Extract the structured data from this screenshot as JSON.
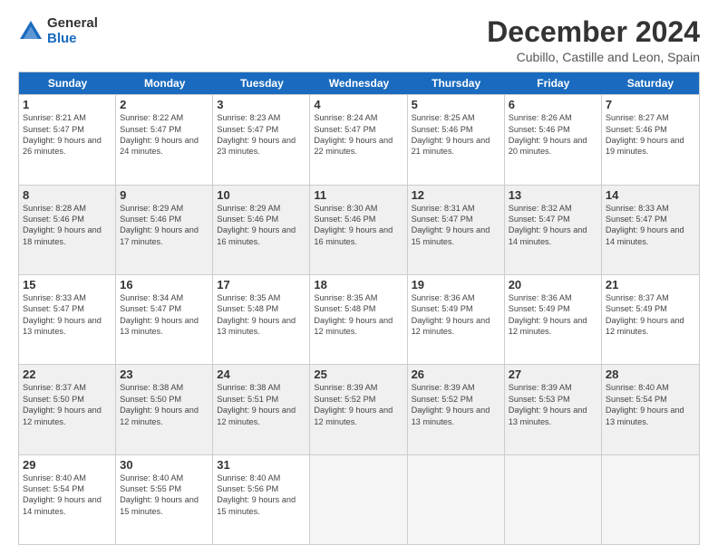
{
  "logo": {
    "general": "General",
    "blue": "Blue"
  },
  "title": "December 2024",
  "location": "Cubillo, Castille and Leon, Spain",
  "header": {
    "days": [
      "Sunday",
      "Monday",
      "Tuesday",
      "Wednesday",
      "Thursday",
      "Friday",
      "Saturday"
    ]
  },
  "weeks": [
    [
      {
        "day": "1",
        "sunrise": "Sunrise: 8:21 AM",
        "sunset": "Sunset: 5:47 PM",
        "daylight": "Daylight: 9 hours and 26 minutes.",
        "shaded": false
      },
      {
        "day": "2",
        "sunrise": "Sunrise: 8:22 AM",
        "sunset": "Sunset: 5:47 PM",
        "daylight": "Daylight: 9 hours and 24 minutes.",
        "shaded": false
      },
      {
        "day": "3",
        "sunrise": "Sunrise: 8:23 AM",
        "sunset": "Sunset: 5:47 PM",
        "daylight": "Daylight: 9 hours and 23 minutes.",
        "shaded": false
      },
      {
        "day": "4",
        "sunrise": "Sunrise: 8:24 AM",
        "sunset": "Sunset: 5:47 PM",
        "daylight": "Daylight: 9 hours and 22 minutes.",
        "shaded": false
      },
      {
        "day": "5",
        "sunrise": "Sunrise: 8:25 AM",
        "sunset": "Sunset: 5:46 PM",
        "daylight": "Daylight: 9 hours and 21 minutes.",
        "shaded": false
      },
      {
        "day": "6",
        "sunrise": "Sunrise: 8:26 AM",
        "sunset": "Sunset: 5:46 PM",
        "daylight": "Daylight: 9 hours and 20 minutes.",
        "shaded": false
      },
      {
        "day": "7",
        "sunrise": "Sunrise: 8:27 AM",
        "sunset": "Sunset: 5:46 PM",
        "daylight": "Daylight: 9 hours and 19 minutes.",
        "shaded": false
      }
    ],
    [
      {
        "day": "8",
        "sunrise": "Sunrise: 8:28 AM",
        "sunset": "Sunset: 5:46 PM",
        "daylight": "Daylight: 9 hours and 18 minutes.",
        "shaded": true
      },
      {
        "day": "9",
        "sunrise": "Sunrise: 8:29 AM",
        "sunset": "Sunset: 5:46 PM",
        "daylight": "Daylight: 9 hours and 17 minutes.",
        "shaded": true
      },
      {
        "day": "10",
        "sunrise": "Sunrise: 8:29 AM",
        "sunset": "Sunset: 5:46 PM",
        "daylight": "Daylight: 9 hours and 16 minutes.",
        "shaded": true
      },
      {
        "day": "11",
        "sunrise": "Sunrise: 8:30 AM",
        "sunset": "Sunset: 5:46 PM",
        "daylight": "Daylight: 9 hours and 16 minutes.",
        "shaded": true
      },
      {
        "day": "12",
        "sunrise": "Sunrise: 8:31 AM",
        "sunset": "Sunset: 5:47 PM",
        "daylight": "Daylight: 9 hours and 15 minutes.",
        "shaded": true
      },
      {
        "day": "13",
        "sunrise": "Sunrise: 8:32 AM",
        "sunset": "Sunset: 5:47 PM",
        "daylight": "Daylight: 9 hours and 14 minutes.",
        "shaded": true
      },
      {
        "day": "14",
        "sunrise": "Sunrise: 8:33 AM",
        "sunset": "Sunset: 5:47 PM",
        "daylight": "Daylight: 9 hours and 14 minutes.",
        "shaded": true
      }
    ],
    [
      {
        "day": "15",
        "sunrise": "Sunrise: 8:33 AM",
        "sunset": "Sunset: 5:47 PM",
        "daylight": "Daylight: 9 hours and 13 minutes.",
        "shaded": false
      },
      {
        "day": "16",
        "sunrise": "Sunrise: 8:34 AM",
        "sunset": "Sunset: 5:47 PM",
        "daylight": "Daylight: 9 hours and 13 minutes.",
        "shaded": false
      },
      {
        "day": "17",
        "sunrise": "Sunrise: 8:35 AM",
        "sunset": "Sunset: 5:48 PM",
        "daylight": "Daylight: 9 hours and 13 minutes.",
        "shaded": false
      },
      {
        "day": "18",
        "sunrise": "Sunrise: 8:35 AM",
        "sunset": "Sunset: 5:48 PM",
        "daylight": "Daylight: 9 hours and 12 minutes.",
        "shaded": false
      },
      {
        "day": "19",
        "sunrise": "Sunrise: 8:36 AM",
        "sunset": "Sunset: 5:49 PM",
        "daylight": "Daylight: 9 hours and 12 minutes.",
        "shaded": false
      },
      {
        "day": "20",
        "sunrise": "Sunrise: 8:36 AM",
        "sunset": "Sunset: 5:49 PM",
        "daylight": "Daylight: 9 hours and 12 minutes.",
        "shaded": false
      },
      {
        "day": "21",
        "sunrise": "Sunrise: 8:37 AM",
        "sunset": "Sunset: 5:49 PM",
        "daylight": "Daylight: 9 hours and 12 minutes.",
        "shaded": false
      }
    ],
    [
      {
        "day": "22",
        "sunrise": "Sunrise: 8:37 AM",
        "sunset": "Sunset: 5:50 PM",
        "daylight": "Daylight: 9 hours and 12 minutes.",
        "shaded": true
      },
      {
        "day": "23",
        "sunrise": "Sunrise: 8:38 AM",
        "sunset": "Sunset: 5:50 PM",
        "daylight": "Daylight: 9 hours and 12 minutes.",
        "shaded": true
      },
      {
        "day": "24",
        "sunrise": "Sunrise: 8:38 AM",
        "sunset": "Sunset: 5:51 PM",
        "daylight": "Daylight: 9 hours and 12 minutes.",
        "shaded": true
      },
      {
        "day": "25",
        "sunrise": "Sunrise: 8:39 AM",
        "sunset": "Sunset: 5:52 PM",
        "daylight": "Daylight: 9 hours and 12 minutes.",
        "shaded": true
      },
      {
        "day": "26",
        "sunrise": "Sunrise: 8:39 AM",
        "sunset": "Sunset: 5:52 PM",
        "daylight": "Daylight: 9 hours and 13 minutes.",
        "shaded": true
      },
      {
        "day": "27",
        "sunrise": "Sunrise: 8:39 AM",
        "sunset": "Sunset: 5:53 PM",
        "daylight": "Daylight: 9 hours and 13 minutes.",
        "shaded": true
      },
      {
        "day": "28",
        "sunrise": "Sunrise: 8:40 AM",
        "sunset": "Sunset: 5:54 PM",
        "daylight": "Daylight: 9 hours and 13 minutes.",
        "shaded": true
      }
    ],
    [
      {
        "day": "29",
        "sunrise": "Sunrise: 8:40 AM",
        "sunset": "Sunset: 5:54 PM",
        "daylight": "Daylight: 9 hours and 14 minutes.",
        "shaded": false
      },
      {
        "day": "30",
        "sunrise": "Sunrise: 8:40 AM",
        "sunset": "Sunset: 5:55 PM",
        "daylight": "Daylight: 9 hours and 15 minutes.",
        "shaded": false
      },
      {
        "day": "31",
        "sunrise": "Sunrise: 8:40 AM",
        "sunset": "Sunset: 5:56 PM",
        "daylight": "Daylight: 9 hours and 15 minutes.",
        "shaded": false
      },
      null,
      null,
      null,
      null
    ]
  ]
}
